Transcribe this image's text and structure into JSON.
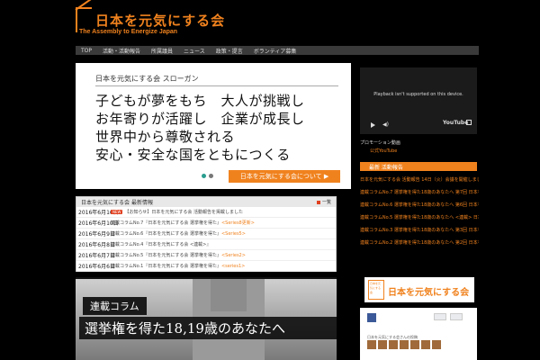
{
  "header": {
    "logo_title": "日本を元気にする会",
    "logo_subtitle": "The Assembly to Energize Japan"
  },
  "nav": {
    "items": [
      "TOP",
      "活動・活動報告",
      "所属議員",
      "ニュース",
      "政策・提言",
      "ボランティア募集"
    ]
  },
  "slogan": {
    "heading": "日本を元気にする会 スローガン",
    "lines": [
      "子どもが夢をもち　大人が挑戦し",
      "お年寄りが活躍し　企業が成長し",
      "世界中から尊敬される",
      "安心・安全な国をともにつくる"
    ],
    "about_button": "日本を元気にする会について ▶"
  },
  "news": {
    "title": "日本を元気にする会 最新情報",
    "more": "一覧",
    "badge": "NEW",
    "items": [
      {
        "date": "2016年6月16日",
        "text": "【お知らせ】日本を元気にする会 活動報告を掲載しました",
        "link": ""
      },
      {
        "date": "2016年6月10日",
        "text": "連載コラムNo.7『日本を元気にする会 選挙権を得た』",
        "link": "<Series8更新>"
      },
      {
        "date": "2016年6月9日",
        "text": "連載コラムNo.6『日本を元気にする会 選挙権を得た』",
        "link": "<Series5>"
      },
      {
        "date": "2016年6月8日",
        "text": "連載コラムNo.4『日本を元気にする会 <連載>』",
        "link": ""
      },
      {
        "date": "2016年6月7日",
        "text": "連載コラムNo.5『日本を元気にする会 選挙権を得た』",
        "link": "<Series2>"
      },
      {
        "date": "2016年6月6日",
        "text": "連載コラムNo.1『日本を元気にする会 選挙権を得た』",
        "link": "<series1>"
      }
    ]
  },
  "banner": {
    "tag": "連載コラム",
    "title": "選挙権を得た18,19歳のあなたへ"
  },
  "video": {
    "message": "Playback isn't supported on this device.",
    "youtube_label": "YouTube"
  },
  "sidebar": {
    "video_caption": "プロモーション動画",
    "youtube_link": "公式YouTube",
    "heading": "最新 活動報告",
    "items": [
      "日本を元気にする会 活動報告 14日（火）会議を開催しました",
      "連載コラムNo.7 選挙権を得た18歳のあなたへ 第7回 日本を元気にする会",
      "連載コラムNo.6 選挙権を得た18歳のあなたへ 第6回 日本を元気にする会",
      "連載コラムNo.5 選挙権を得た18歳のあなたへ <連載> 日本を元気にする会",
      "連載コラムNo.3 選挙権を得た18歳のあなたへ 第3回 日本を元気にする会",
      "連載コラムNo.2 選挙権を得た18歳のあなたへ 第2回 日本を元気にする会"
    ],
    "logo_small_text": "日本を元気にする会",
    "logo_text": "日本を元気にする会",
    "fb_caption": "日本を元気にする会さんの投稿"
  },
  "colors": {
    "accent": "#f0821e",
    "background": "#000000",
    "news_badge": "#e04020"
  }
}
